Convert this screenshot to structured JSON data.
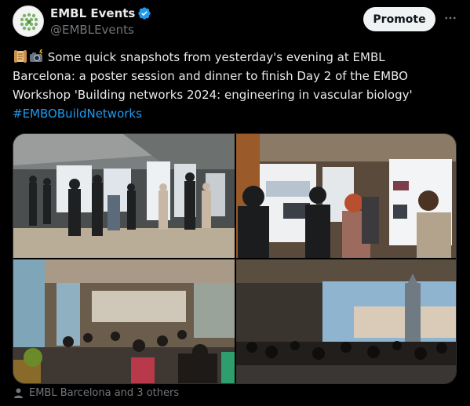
{
  "tweet": {
    "display_name": "EMBL Events",
    "handle": "@EMBLEvents",
    "promote_label": "Promote",
    "text_lines": [
      "Some quick snapshots from yesterday's evening at EMBL",
      "Barcelona: a poster session and dinner to finish Day 2 of the EMBO",
      "Workshop 'Building networks 2024: engineering in vascular biology'"
    ],
    "hashtag": "#EMBOBuildNetworks",
    "tagged_people": "EMBL Barcelona and 3 others"
  },
  "icons": {
    "verified": "verified-badge-icon",
    "more": "more-options-icon",
    "scroll_emoji": "scroll-emoji-icon",
    "camera_emoji": "camera-flash-emoji-icon",
    "person": "person-icon"
  },
  "media": [
    {
      "scene": "poster session in hall"
    },
    {
      "scene": "attendees reading posters"
    },
    {
      "scene": "dinner in restaurant"
    },
    {
      "scene": "dinner on terrace at sunset"
    }
  ],
  "colors": {
    "background": "#000000",
    "text": "#e7e9ea",
    "secondary": "#71767b",
    "link": "#1d9bf0",
    "verified": "#1d9bf0",
    "promote_bg": "#eff3f4"
  }
}
